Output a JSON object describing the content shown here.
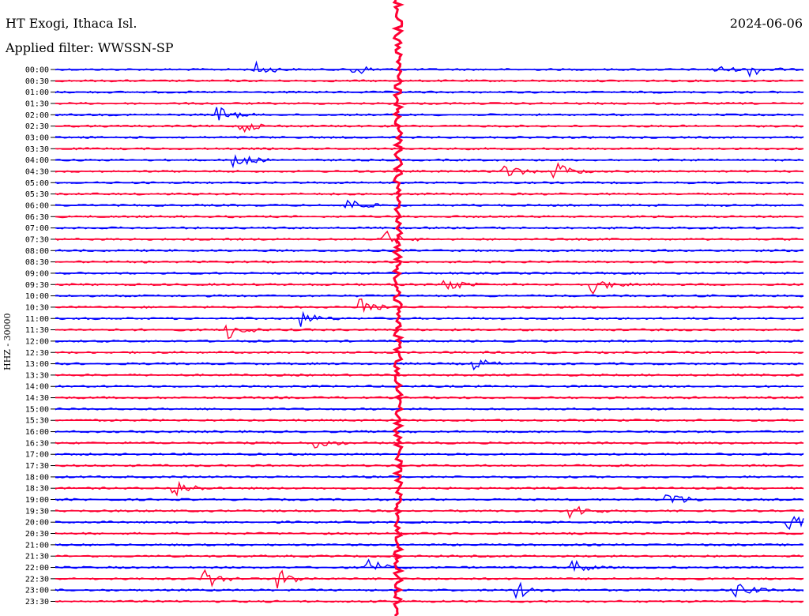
{
  "header": {
    "station": "HT Exogi, Ithaca Isl.",
    "filter": "Applied filter: WWSSN-SP",
    "date": "2024-06-06"
  },
  "chart_data": {
    "type": "line",
    "ylabel": "HHZ - 30000",
    "title": "",
    "xlabel": "",
    "row_labels": [
      "00:00",
      "00:30",
      "01:00",
      "01:30",
      "02:00",
      "02:30",
      "03:00",
      "03:30",
      "04:00",
      "04:30",
      "05:00",
      "05:30",
      "06:00",
      "06:30",
      "07:00",
      "07:30",
      "08:00",
      "08:30",
      "09:00",
      "09:30",
      "10:00",
      "10:30",
      "11:00",
      "11:30",
      "12:00",
      "12:30",
      "13:00",
      "13:30",
      "14:00",
      "14:30",
      "15:00",
      "15:30",
      "16:00",
      "16:30",
      "17:00",
      "17:30",
      "18:00",
      "18:30",
      "19:00",
      "19:30",
      "20:00",
      "20:30",
      "21:00",
      "21:30",
      "22:00",
      "22:30",
      "23:00",
      "23:30"
    ],
    "row_colors": [
      "#0000ff",
      "#ff0033"
    ],
    "grid": false,
    "events": [
      {
        "row": 0,
        "t": 0.27,
        "amp": 1.0
      },
      {
        "row": 0,
        "t": 0.4,
        "amp": 1.0
      },
      {
        "row": 0,
        "t": 0.88,
        "amp": 0.8
      },
      {
        "row": 0,
        "t": 0.93,
        "amp": 1.0
      },
      {
        "row": 4,
        "t": 0.22,
        "amp": 1.2
      },
      {
        "row": 5,
        "t": 0.25,
        "amp": 1.0
      },
      {
        "row": 8,
        "t": 0.24,
        "amp": 1.4
      },
      {
        "row": 9,
        "t": 0.6,
        "amp": 1.3
      },
      {
        "row": 9,
        "t": 0.67,
        "amp": 1.5
      },
      {
        "row": 12,
        "t": 0.39,
        "amp": 1.2
      },
      {
        "row": 15,
        "t": 0.44,
        "amp": 1.5
      },
      {
        "row": 19,
        "t": 0.52,
        "amp": 1.4
      },
      {
        "row": 19,
        "t": 0.72,
        "amp": 1.3
      },
      {
        "row": 21,
        "t": 0.41,
        "amp": 1.6
      },
      {
        "row": 22,
        "t": 0.33,
        "amp": 1.2
      },
      {
        "row": 23,
        "t": 0.23,
        "amp": 1.5
      },
      {
        "row": 26,
        "t": 0.56,
        "amp": 1.0
      },
      {
        "row": 33,
        "t": 0.35,
        "amp": 1.0
      },
      {
        "row": 37,
        "t": 0.16,
        "amp": 1.5
      },
      {
        "row": 38,
        "t": 0.82,
        "amp": 1.4
      },
      {
        "row": 39,
        "t": 0.69,
        "amp": 1.3
      },
      {
        "row": 40,
        "t": 0.98,
        "amp": 1.5
      },
      {
        "row": 44,
        "t": 0.42,
        "amp": 1.3
      },
      {
        "row": 44,
        "t": 0.69,
        "amp": 1.3
      },
      {
        "row": 45,
        "t": 0.2,
        "amp": 1.7
      },
      {
        "row": 45,
        "t": 0.3,
        "amp": 1.5
      },
      {
        "row": 46,
        "t": 0.62,
        "amp": 1.2
      },
      {
        "row": 46,
        "t": 0.91,
        "amp": 1.2
      }
    ],
    "main_event": {
      "row": 15,
      "t": 0.458,
      "amp": 12.0
    }
  }
}
